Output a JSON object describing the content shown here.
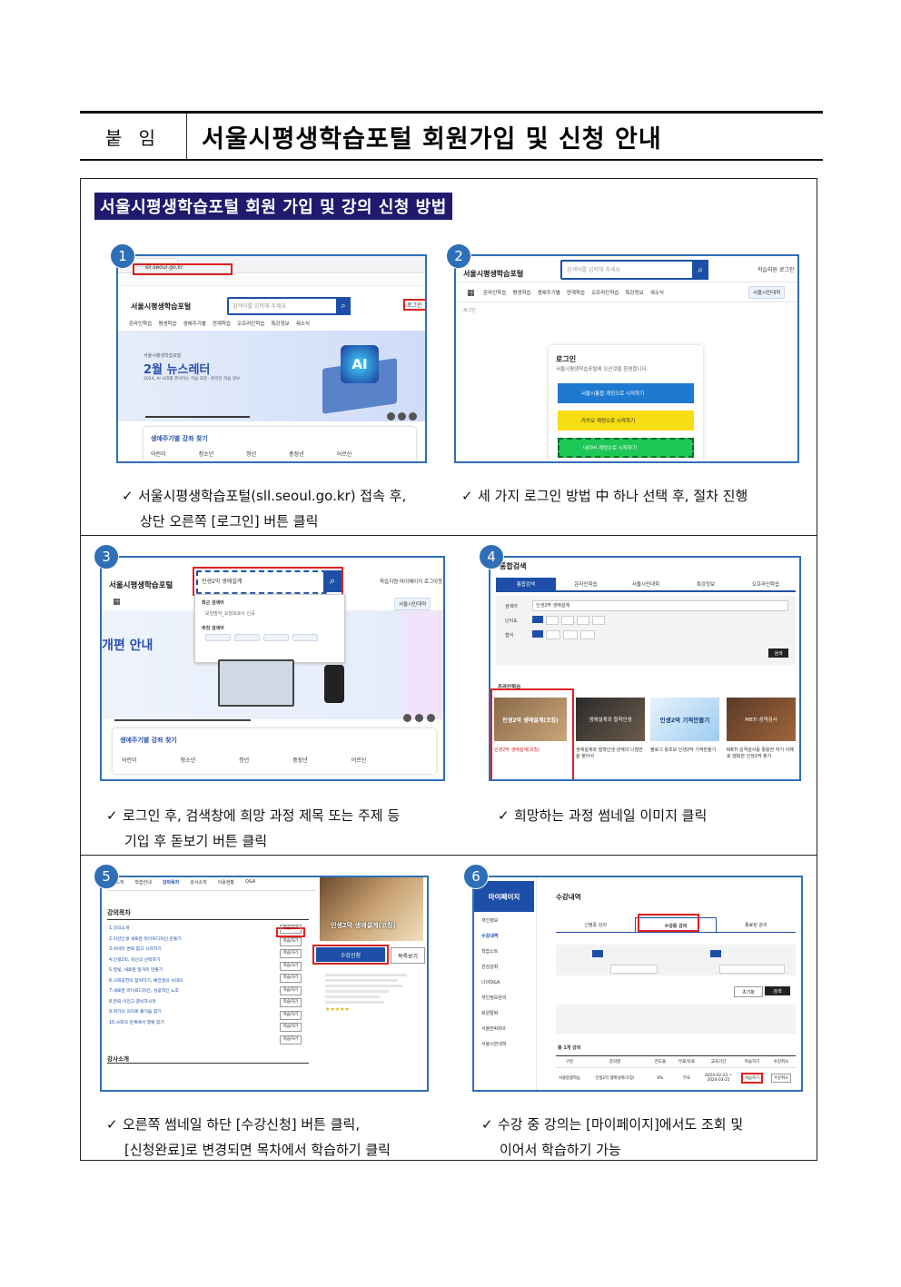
{
  "header": {
    "label": "붙 임",
    "title": "서울시평생학습포털 회원가입 및 신청 안내"
  },
  "section_title": "서울시평생학습포털 회원 가입 및 강의 신청 방법",
  "steps": [
    {
      "num": "1",
      "caption_line1": "서울시평생학습포털(sll.seoul.go.kr)  접속 후,",
      "caption_line2": "상단 오른쪽 [로그인] 버튼 클릭"
    },
    {
      "num": "2",
      "caption_line1": "세 가지 로그인 방법 中 하나 선택 후, 절차 진행",
      "caption_line2": ""
    },
    {
      "num": "3",
      "caption_line1": "로그인 후, 검색창에 희망 과정 제목 또는 주제 등",
      "caption_line2": "기입 후 돋보기 버튼 클릭"
    },
    {
      "num": "4",
      "caption_line1": "희망하는 과정 썸네일 이미지 클릭",
      "caption_line2": ""
    },
    {
      "num": "5",
      "caption_line1": "오른쪽 썸네일 하단 [수강신청] 버튼 클릭,",
      "caption_line2": "[신청완료]로 변경되면 목차에서 학습하기 클릭"
    },
    {
      "num": "6",
      "caption_line1": "수강 중 강의는 [마이페이지]에서도 조회 및",
      "caption_line2": "이어서 학습하기 가능"
    }
  ],
  "shot1": {
    "url": "sll.seoul.go.kr",
    "logo": "서울시평생학습포털",
    "search_placeholder": "검색어를 입력해 주세요",
    "login": "로그인",
    "nav": [
      "온라인학습",
      "평생학습",
      "생애주기별",
      "연계학습",
      "오프라인학습",
      "특강정보",
      "새소식"
    ],
    "banner_small": "서울시평생학습포털",
    "banner_title": "2월 뉴스레터",
    "banner_sub": "2024, AI 시대를 준비하는 학습 과정 · 온라인 학습 정보",
    "ai_text": "AI",
    "finder_title": "생애주기별 강좌 찾기",
    "finder_items": [
      "어린이",
      "청소년",
      "청년",
      "중장년",
      "어르신"
    ]
  },
  "shot2": {
    "logo": "서울시평생학습포털",
    "search_placeholder": "검색어를 입력해 주세요",
    "top_links": "학습지원  로그인",
    "nav": [
      "온라인학습",
      "평생학습",
      "생애주기별",
      "연계학습",
      "오프라인학습",
      "특강정보",
      "새소식"
    ],
    "badge": "서울시민대학",
    "breadcrumb": "로그인",
    "login_title": "로그인",
    "login_sub": "서울시평생학습포털에 오신것을 환영합니다.",
    "btn_seoul": "서울시통합 계정으로 시작하기",
    "btn_kakao": "카카오 계정으로 시작하기",
    "btn_naver": "네이버 계정으로 시작하기"
  },
  "shot3": {
    "logo": "서울시평생학습포털",
    "search_value": "인생2막 생애설계",
    "top_links": "학습지원  마이페이지  로그아웃",
    "recent_label": "최근 검색어",
    "recent_item": "모임방식_요양보호사 인공",
    "recommend_label": "추천 검색어",
    "banner_title": "개편 안내",
    "badge": "서울시민대학",
    "finder_title": "생애주기별 강좌 찾기",
    "finder_items": [
      "어린이",
      "청소년",
      "청년",
      "중장년",
      "어르신"
    ]
  },
  "shot4": {
    "title": "통합검색",
    "tabs": [
      "통합검색",
      "온라인학습",
      "서울시민대학",
      "특강정보",
      "오프라인학습"
    ],
    "keyword_label": "검색어",
    "keyword_value": "인생2막 생애설계",
    "level_label": "난이도",
    "format_label": "형식",
    "search_btn": "검색",
    "result_label": "온라인학습",
    "cards": [
      {
        "thumb": "인생2막 생애설계(코칭)",
        "title": "인생2막 생애설계(코칭)"
      },
      {
        "thumb": "생애설계와 철학인생",
        "title": "생애설계와 철학인생 관계의 나침반을 찾아서"
      },
      {
        "thumb": "인생2막 기적만들기",
        "title": "블로그 왕초보 인생2막 기적만들기"
      },
      {
        "thumb": "MBTI 성격검사",
        "title": "MBTI 성격검사를 활용한 자기 이해로 행복한 인생2막 찾기"
      }
    ]
  },
  "shot5": {
    "tabs": [
      "과정소개",
      "학습안내",
      "강의목차",
      "강사소개",
      "이용현황",
      "Q&A"
    ],
    "toc_title": "강의목차",
    "lessons": [
      "1.강의소개",
      "2.미션인생 새로운 라이프디자인 만들기",
      "3.아바타 변화 없고 시작하기",
      "4.인생2막, 자신의 선택하기",
      "5.일빛, 새로운 일거리 만들기",
      "6.사회공헌의 참여하기, 예전엔의 시대의",
      "7.새로운 라이프디자인, 성공적인 노후",
      "8.은퇴 이전고 준비하시라",
      "9.여가의 의미로 즐거움 찾기",
      "10.사회의 관계에서 행복 찾기"
    ],
    "learn_btn": "학습하기",
    "thumb_title": "인생2막 생애설계(코칭)",
    "apply_btn": "수강신청",
    "wish_btn": "목록보기",
    "instructor_title": "강사소개"
  },
  "shot6": {
    "mypage": "마이페이지",
    "title": "수강내역",
    "side_items": [
      "개인정보",
      "수강내역",
      "학습노트",
      "관심강좌",
      "나의Q&A",
      "개인정보관리",
      "회원탈퇴",
      "서울런4050",
      "서울시민대학"
    ],
    "tabs": [
      "신청중 강의",
      "수강중 강의",
      "종료된 강의"
    ],
    "search_btn": "검색",
    "reset_btn": "초기화",
    "count": "총 1개 강의",
    "table_headers": [
      "구분",
      "강의명",
      "진도율",
      "무료/유료",
      "교육기간",
      "학습하기",
      "수강취소"
    ],
    "row": [
      "서울평생학습",
      "인생2막 생애설계(코칭)",
      "0%",
      "무료",
      "2024-02-23 ~ 2024-03-25",
      "학습하기",
      "수강취소"
    ]
  }
}
